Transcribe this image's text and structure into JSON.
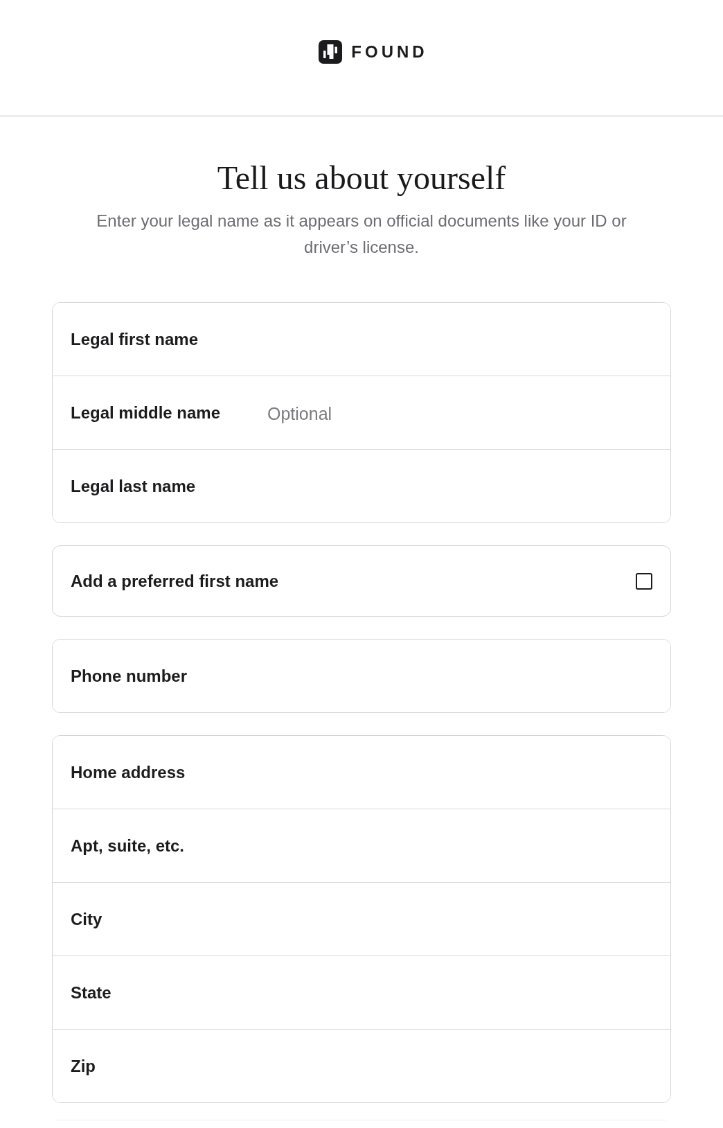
{
  "header": {
    "logo_text": "FOUND"
  },
  "title": "Tell us about yourself",
  "subtitle": "Enter your legal name as it appears on official documents like your ID or driver’s license.",
  "groups": [
    {
      "kind": "fields",
      "fields": [
        {
          "label": "Legal first name"
        },
        {
          "label": "Legal middle name",
          "placeholder": "Optional"
        },
        {
          "label": "Legal last name"
        }
      ]
    },
    {
      "kind": "checkbox",
      "label": "Add a preferred first name",
      "checked": false
    },
    {
      "kind": "fields",
      "fields": [
        {
          "label": "Phone number"
        }
      ]
    },
    {
      "kind": "fields",
      "fields": [
        {
          "label": "Home address"
        },
        {
          "label": "Apt, suite, etc."
        },
        {
          "label": "City"
        },
        {
          "label": "State"
        },
        {
          "label": "Zip"
        }
      ]
    }
  ]
}
